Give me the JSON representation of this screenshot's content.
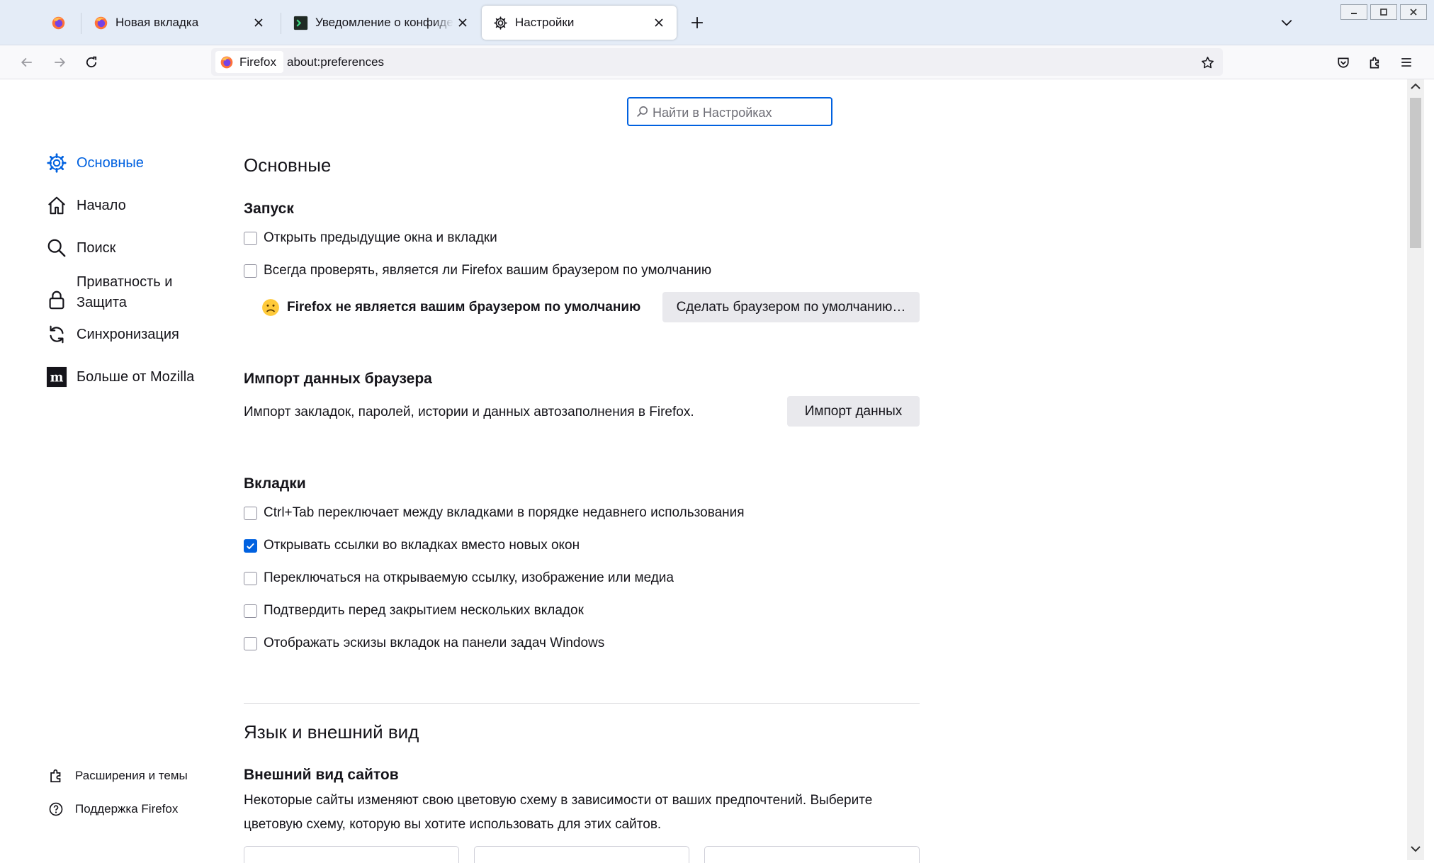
{
  "tabs": [
    {
      "title": "Новая вкладка",
      "favicon": "firefox-icon",
      "selected": false
    },
    {
      "title": "Уведомление о конфиденциальности",
      "favicon": "terminal-icon",
      "selected": false
    },
    {
      "title": "Настройки",
      "favicon": "gear-icon",
      "selected": true
    }
  ],
  "urlbar": {
    "identity_label": "Firefox",
    "url": "about:preferences"
  },
  "search": {
    "placeholder": "Найти в Настройках"
  },
  "sidebar": {
    "categories": [
      {
        "label": "Основные",
        "icon": "gear-icon",
        "selected": true
      },
      {
        "label": "Начало",
        "icon": "home-icon"
      },
      {
        "label": "Поиск",
        "icon": "search-icon"
      },
      {
        "label": "Приватность и Защита",
        "icon": "lock-icon"
      },
      {
        "label": "Синхронизация",
        "icon": "sync-icon"
      },
      {
        "label": "Больше от Mozilla",
        "icon": "mozilla-icon"
      }
    ],
    "footer": [
      {
        "label": "Расширения и темы",
        "icon": "puzzle-icon"
      },
      {
        "label": "Поддержка Firefox",
        "icon": "help-icon"
      }
    ]
  },
  "general": {
    "heading": "Основные",
    "startup": {
      "heading": "Запуск",
      "restore_session": {
        "label": "Открыть предыдущие окна и вкладки",
        "checked": false
      },
      "check_default": {
        "label": "Всегда проверять, является ли Firefox вашим браузером по умолчанию",
        "checked": false
      },
      "not_default_status": "Firefox не является вашим браузером по умолчанию",
      "set_default_button": "Сделать браузером по умолчанию…"
    },
    "import": {
      "heading": "Импорт данных браузера",
      "description": "Импорт закладок, паролей, истории и данных автозаполнения в Firefox.",
      "button": "Импорт данных"
    },
    "tabs": {
      "heading": "Вкладки",
      "options": [
        {
          "label": "Ctrl+Tab переключает между вкладками в порядке недавнего использования",
          "checked": false
        },
        {
          "label": "Открывать ссылки во вкладках вместо новых окон",
          "checked": true
        },
        {
          "label": "Переключаться на открываемую ссылку, изображение или медиа",
          "checked": false
        },
        {
          "label": "Подтвердить перед закрытием нескольких вкладок",
          "checked": false
        },
        {
          "label": "Отображать эскизы вкладок на панели задач Windows",
          "checked": false
        }
      ]
    }
  },
  "language_appearance": {
    "heading": "Язык и внешний вид",
    "website_appearance": {
      "heading": "Внешний вид сайтов",
      "description_line1": "Некоторые сайты изменяют свою цветовую схему в зависимости от ваших предпочтений. Выберите",
      "description_line2": "цветовую схему, которую вы хотите использовать для этих сайтов."
    }
  },
  "colors": {
    "accent": "#0061e0",
    "tabstrip": "#e4ecf7",
    "button": "#e9e9ed"
  }
}
